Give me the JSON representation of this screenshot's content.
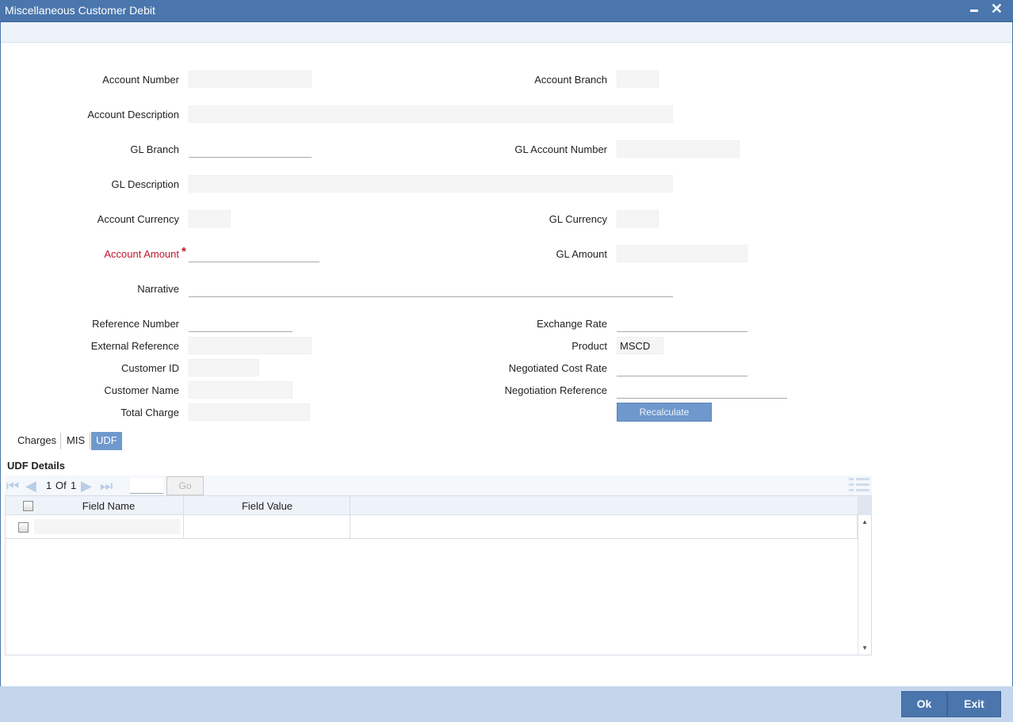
{
  "window": {
    "title": "Miscellaneous Customer Debit",
    "minimize_icon": "minimize-icon",
    "close_icon": "close-icon",
    "close_glyph": "✕"
  },
  "form": {
    "account_number": {
      "label": "Account Number",
      "value": ""
    },
    "account_branch": {
      "label": "Account Branch",
      "value": ""
    },
    "account_description": {
      "label": "Account Description",
      "value": ""
    },
    "gl_branch": {
      "label": "GL Branch",
      "value": ""
    },
    "gl_account_number": {
      "label": "GL Account Number",
      "value": ""
    },
    "gl_description": {
      "label": "GL Description",
      "value": ""
    },
    "account_currency": {
      "label": "Account Currency",
      "value": ""
    },
    "gl_currency": {
      "label": "GL Currency",
      "value": ""
    },
    "account_amount": {
      "label": "Account Amount",
      "required_marker": "*",
      "value": ""
    },
    "gl_amount": {
      "label": "GL Amount",
      "value": ""
    },
    "narrative": {
      "label": "Narrative",
      "value": ""
    },
    "reference_number": {
      "label": "Reference Number",
      "value": ""
    },
    "exchange_rate": {
      "label": "Exchange Rate",
      "value": ""
    },
    "external_reference": {
      "label": "External Reference",
      "value": ""
    },
    "product": {
      "label": "Product",
      "value": "MSCD"
    },
    "customer_id": {
      "label": "Customer ID",
      "value": ""
    },
    "negotiated_cost_rate": {
      "label": "Negotiated Cost Rate",
      "value": ""
    },
    "customer_name": {
      "label": "Customer Name",
      "value": ""
    },
    "negotiation_reference": {
      "label": "Negotiation Reference",
      "value": ""
    },
    "total_charge": {
      "label": "Total Charge",
      "value": ""
    },
    "recalculate_label": "Recalculate"
  },
  "tabs": [
    {
      "label": "Charges",
      "active": false
    },
    {
      "label": "MIS",
      "active": false
    },
    {
      "label": "UDF",
      "active": true
    }
  ],
  "udf": {
    "section_title": "UDF Details",
    "pager": {
      "current": "1",
      "of_label": "Of",
      "total": "1",
      "go_label": "Go"
    },
    "columns": [
      "Field Name",
      "Field Value"
    ],
    "rows": [
      {
        "field_name": "",
        "field_value": ""
      }
    ]
  },
  "footer": {
    "ok_label": "Ok",
    "exit_label": "Exit"
  }
}
